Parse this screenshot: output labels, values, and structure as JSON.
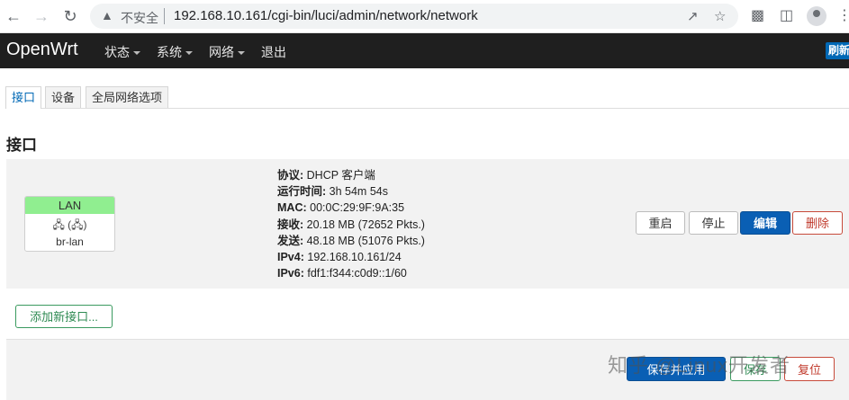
{
  "browser": {
    "insecure_label": "不安全",
    "url": "192.168.10.161/cgi-bin/luci/admin/network/network"
  },
  "header": {
    "brand": "OpenWrt",
    "menu": [
      "状态",
      "系统",
      "网络",
      "退出"
    ],
    "refresh_label": "刷新"
  },
  "tabs": [
    "接口",
    "设备",
    "全局网络选项"
  ],
  "section_title": "接口",
  "interface": {
    "name": "LAN",
    "icons": "(",
    "device": "br-lan",
    "badge_color": "#90ee90",
    "details": [
      {
        "label": "协议:",
        "value": "DHCP 客户端"
      },
      {
        "label": "运行时间:",
        "value": "3h 54m 54s"
      },
      {
        "label": "MAC:",
        "value": "00:0C:29:9F:9A:35"
      },
      {
        "label": "接收:",
        "value": "20.18 MB (72652 Pkts.)"
      },
      {
        "label": "发送:",
        "value": "48.18 MB (51076 Pkts.)"
      },
      {
        "label": "IPv4:",
        "value": "192.168.10.161/24"
      },
      {
        "label": "IPv6:",
        "value": "fdf1:f344:c0d9::1/60"
      }
    ],
    "actions": {
      "restart": "重启",
      "stop": "停止",
      "edit": "编辑",
      "delete": "删除"
    }
  },
  "add_interface_label": "添加新接口...",
  "footer": {
    "save_apply": "保存并应用",
    "save": "保存",
    "reset": "复位"
  },
  "watermark": "知乎 @Linux开发者",
  "colors": {
    "primary": "#0a5fb4",
    "danger": "#c0392b",
    "success": "#2e8a52",
    "header_bg": "#1f1f1f"
  }
}
